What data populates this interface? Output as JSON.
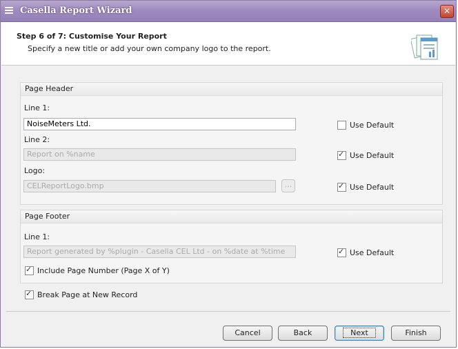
{
  "window": {
    "title": "Casella Report Wizard",
    "close_glyph": "✕"
  },
  "header": {
    "step_title": "Step 6 of 7: Customise Your Report",
    "step_subtitle": "Specify a new title or add your own company logo to the report."
  },
  "page_header": {
    "title": "Page Header",
    "line1": {
      "label": "Line 1:",
      "value": "NoiseMeters Ltd.",
      "use_default_label": "Use Default",
      "use_default": false
    },
    "line2": {
      "label": "Line 2:",
      "value": "Report on %name",
      "use_default_label": "Use Default",
      "use_default": true
    },
    "logo": {
      "label": "Logo:",
      "value": "CELReportLogo.bmp",
      "browse_label": "...",
      "use_default_label": "Use Default",
      "use_default": true
    }
  },
  "page_footer": {
    "title": "Page Footer",
    "line1": {
      "label": "Line 1:",
      "value": "Report generated by %plugin - Casella CEL Ltd - on %date at %time",
      "use_default_label": "Use Default",
      "use_default": true
    },
    "page_number": {
      "label": "Include Page Number (Page X of Y)",
      "checked": true
    }
  },
  "break_page": {
    "label": "Break Page at New Record",
    "checked": true
  },
  "buttons": {
    "cancel": "Cancel",
    "back": "Back",
    "next": "Next",
    "finish": "Finish"
  },
  "icons": {
    "system_menu": "menu-icon",
    "wizard": "report-document-icon"
  },
  "colors": {
    "titlebar": "#a08bc0",
    "close": "#c4442f"
  }
}
